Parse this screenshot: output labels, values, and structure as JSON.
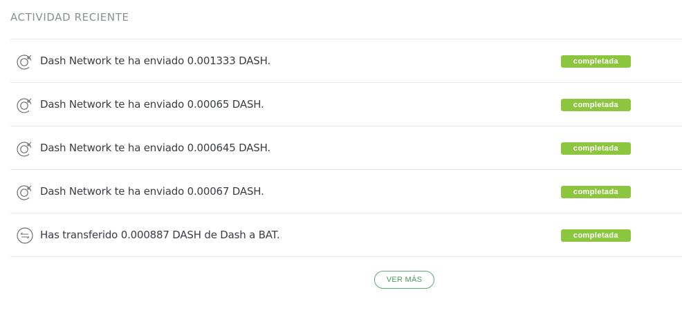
{
  "section": {
    "title": "ACTIVIDAD RECIENTE"
  },
  "activity": [
    {
      "icon": "receive-icon",
      "text": "Dash Network te ha enviado 0.001333 DASH.",
      "status": "completada"
    },
    {
      "icon": "receive-icon",
      "text": "Dash Network te ha enviado 0.00065 DASH.",
      "status": "completada"
    },
    {
      "icon": "receive-icon",
      "text": "Dash Network te ha enviado 0.000645 DASH.",
      "status": "completada"
    },
    {
      "icon": "receive-icon",
      "text": "Dash Network te ha enviado 0.00067 DASH.",
      "status": "completada"
    },
    {
      "icon": "transfer-icon",
      "text": "Has transferido 0.000887 DASH de Dash a BAT.",
      "status": "completada"
    }
  ],
  "footer": {
    "more_label": "VER MÁS"
  },
  "colors": {
    "status_complete": "#8cc63f",
    "button_accent": "#5ba86a"
  }
}
